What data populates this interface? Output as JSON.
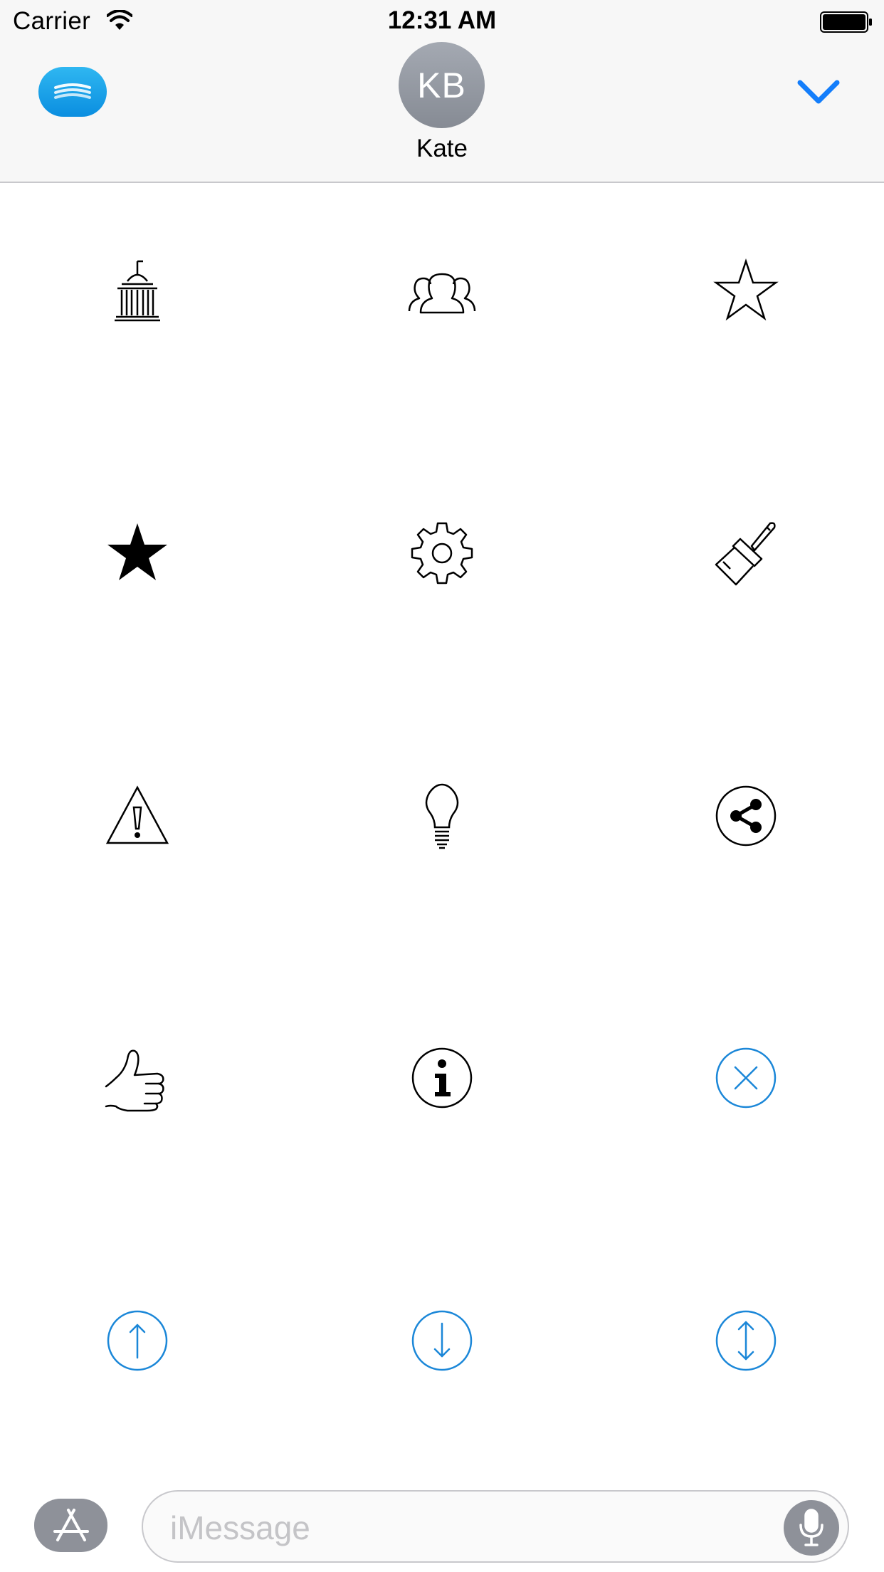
{
  "status_bar": {
    "carrier": "Carrier",
    "time": "12:31 AM"
  },
  "header": {
    "app_icon": "app-drawer-icon",
    "contact_initials": "KB",
    "contact_name": "Kate",
    "collapse_icon": "chevron-down-icon",
    "accent_color": "#147efb"
  },
  "icon_grid": {
    "columns": 3,
    "rows": [
      [
        {
          "icon": "capitol-building-icon",
          "color": "#000000"
        },
        {
          "icon": "group-users-icon",
          "color": "#000000"
        },
        {
          "icon": "star-outline-icon",
          "color": "#000000"
        }
      ],
      [
        {
          "icon": "star-filled-icon",
          "color": "#000000"
        },
        {
          "icon": "gear-icon",
          "color": "#000000"
        },
        {
          "icon": "paintbrush-icon",
          "color": "#000000"
        }
      ],
      [
        {
          "icon": "warning-icon",
          "color": "#000000"
        },
        {
          "icon": "lightbulb-icon",
          "color": "#000000"
        },
        {
          "icon": "share-icon",
          "color": "#000000"
        }
      ],
      [
        {
          "icon": "thumbs-up-icon",
          "color": "#000000"
        },
        {
          "icon": "info-icon",
          "color": "#000000"
        },
        {
          "icon": "close-circle-icon",
          "color": "#1b87d8"
        }
      ],
      [
        {
          "icon": "arrow-up-circle-icon",
          "color": "#1b87d8"
        },
        {
          "icon": "arrow-down-circle-icon",
          "color": "#1b87d8"
        },
        {
          "icon": "arrow-up-down-circle-icon",
          "color": "#1b87d8"
        }
      ]
    ]
  },
  "bottom_bar": {
    "appstore_icon": "app-store-icon",
    "message_placeholder": "iMessage",
    "mic_icon": "microphone-icon"
  }
}
